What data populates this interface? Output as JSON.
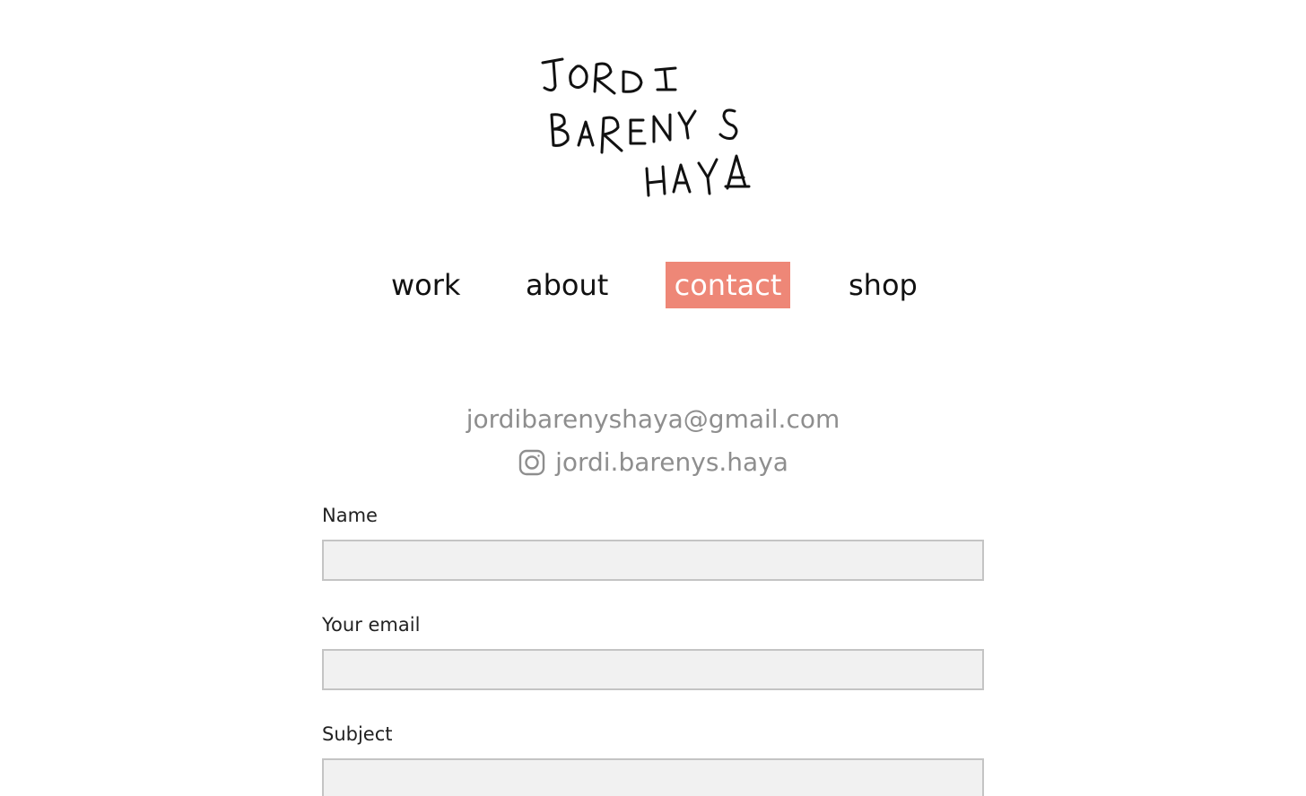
{
  "logo": {
    "alt_text": "JORDI BARENYS HAYA",
    "lines": [
      "JORDI",
      "BARENYS",
      "HAYA"
    ]
  },
  "nav": {
    "items": [
      {
        "label": "work"
      },
      {
        "label": "about"
      },
      {
        "label": "contact",
        "active": true
      },
      {
        "label": "shop"
      }
    ],
    "active_color": "#ee8777"
  },
  "contact": {
    "email": "jordibarenyshaya@gmail.com",
    "instagram_handle": "jordi.barenys.haya",
    "instagram_icon": "instagram-icon",
    "text_color": "#8e8e8e"
  },
  "form": {
    "fields": [
      {
        "label": "Name",
        "value": ""
      },
      {
        "label": "Your email",
        "value": ""
      },
      {
        "label": "Subject",
        "value": ""
      }
    ]
  }
}
